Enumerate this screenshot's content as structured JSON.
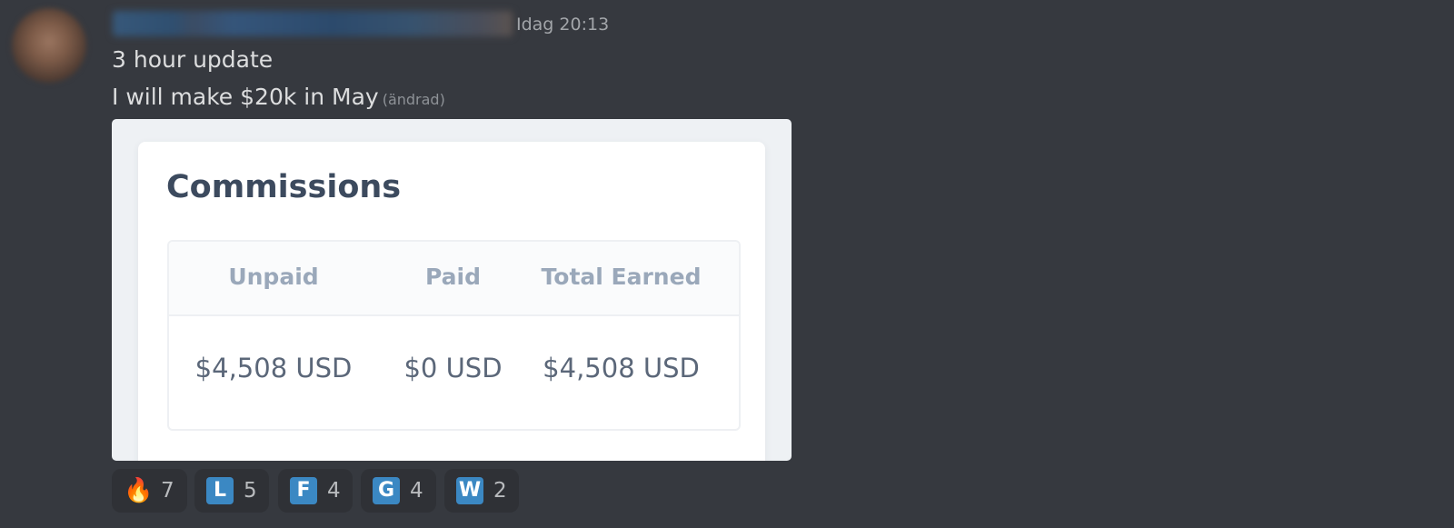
{
  "message": {
    "timestamp": "Idag 20:13",
    "lines": [
      "3 hour update",
      "I will make $20k in May"
    ],
    "edited_label": "(ändrad)"
  },
  "embed": {
    "title": "Commissions",
    "columns": [
      "Unpaid",
      "Paid",
      "Total Earned"
    ],
    "values": [
      "$4,508 USD",
      "$0 USD",
      "$4,508 USD"
    ]
  },
  "reactions": [
    {
      "emoji": "🔥",
      "icon": "fire-emoji",
      "count": "7"
    },
    {
      "emoji": "L",
      "icon": "regional-indicator-l",
      "count": "5"
    },
    {
      "emoji": "F",
      "icon": "regional-indicator-f",
      "count": "4"
    },
    {
      "emoji": "G",
      "icon": "regional-indicator-g",
      "count": "4"
    },
    {
      "emoji": "W",
      "icon": "regional-indicator-w",
      "count": "2"
    }
  ],
  "colors": {
    "background": "#36393f",
    "text": "#dcddde",
    "letter_emoji": "#3b88c3",
    "reaction_bg": "#2f3136"
  }
}
